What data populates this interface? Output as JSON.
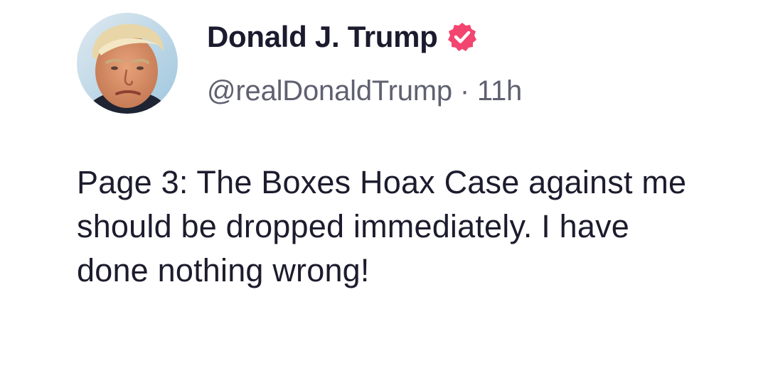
{
  "post": {
    "author": {
      "display_name": "Donald J. Trump",
      "handle": "@realDonaldTrump",
      "verified_icon": "verified-badge-icon",
      "avatar_icon": "profile-avatar"
    },
    "separator": "·",
    "timestamp": "11h",
    "text": "Page 3: The Boxes Hoax Case against me should be dropped immediately. I have done nothing wrong!"
  },
  "colors": {
    "verified_badge": "#f2456f",
    "name_text": "#1b1a2e",
    "meta_text": "#5f6070",
    "body_text": "#1d1c2e",
    "background": "#ffffff"
  }
}
